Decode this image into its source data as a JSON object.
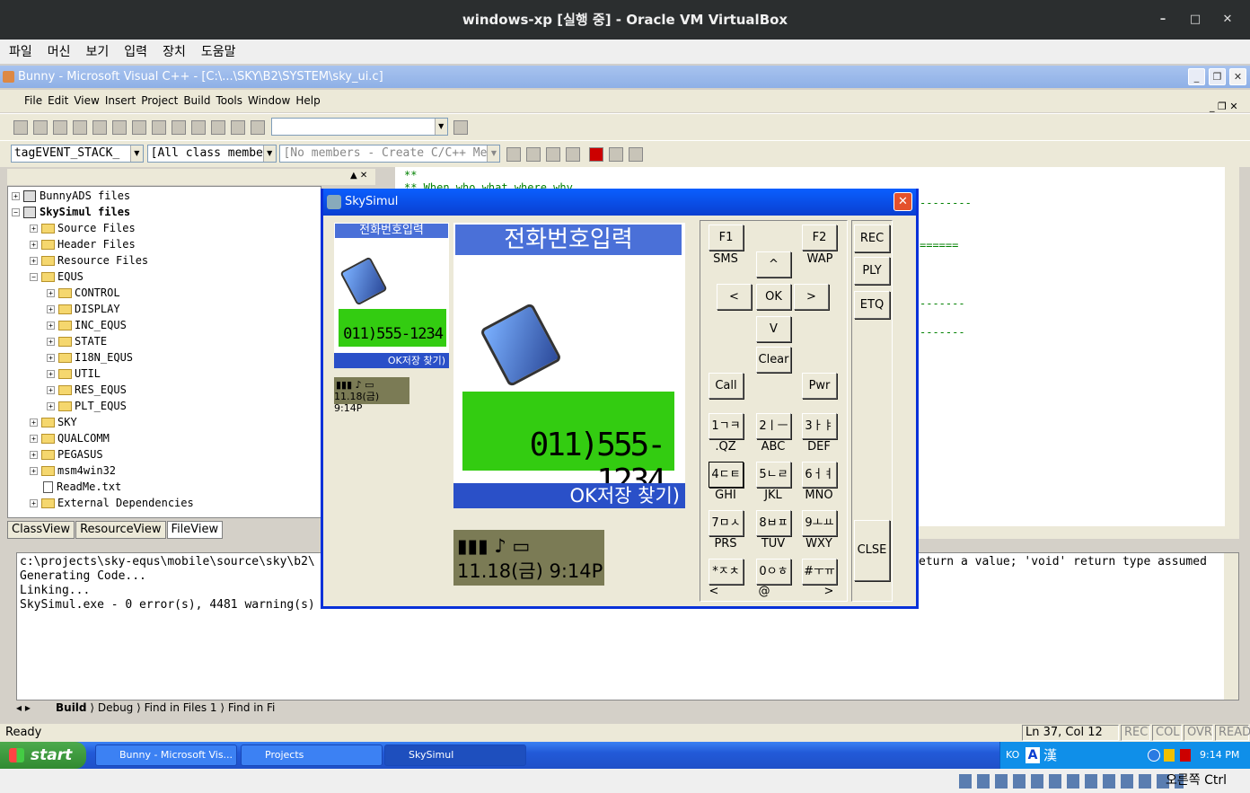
{
  "host": {
    "title": "windows-xp [실행 중] - Oracle VM VirtualBox",
    "menu": [
      "파일",
      "머신",
      "보기",
      "입력",
      "장치",
      "도움말"
    ],
    "status_host_key": "오른쪽 Ctrl"
  },
  "vc": {
    "title": "Bunny - Microsoft Visual C++ - [C:\\...\\SKY\\B2\\SYSTEM\\sky_ui.c]",
    "menu": [
      "File",
      "Edit",
      "View",
      "Insert",
      "Project",
      "Build",
      "Tools",
      "Window",
      "Help"
    ],
    "combo_class": "tagEVENT_STACK_",
    "combo_filter": "[All class members]",
    "combo_members": "[No members - Create C/C++ Memb"
  },
  "tree": {
    "rows": [
      {
        "label": "BunnyADS files"
      },
      {
        "label": "SkySimul files"
      },
      {
        "label": "Source Files"
      },
      {
        "label": "Header Files"
      },
      {
        "label": "Resource Files"
      },
      {
        "label": "EQUS"
      },
      {
        "label": "CONTROL"
      },
      {
        "label": "DISPLAY"
      },
      {
        "label": "INC_EQUS"
      },
      {
        "label": "STATE"
      },
      {
        "label": "I18N_EQUS"
      },
      {
        "label": "UTIL"
      },
      {
        "label": "RES_EQUS"
      },
      {
        "label": "PLT_EQUS"
      },
      {
        "label": "SKY"
      },
      {
        "label": "QUALCOMM"
      },
      {
        "label": "PEGASUS"
      },
      {
        "label": "msm4win32"
      },
      {
        "label": "ReadMe.txt"
      },
      {
        "label": "External Dependencies"
      }
    ],
    "tabs": [
      "ClassView",
      "ResourceView",
      "FileView"
    ]
  },
  "editor": {
    "line1": "**",
    "line2": "** When          who           what  where  why",
    "dashes": [
      "--------",
      "======",
      "-------",
      "-------"
    ]
  },
  "output": {
    "lines": [
      "c:\\projects\\sky-equs\\mobile\\source\\sky\\b2\\",
      "Generating Code...",
      "Linking...",
      "",
      "SkySimul.exe - 0 error(s), 4481 warning(s)"
    ],
    "right_text": "eturn a value; 'void' return type assumed",
    "tabs": [
      "Build",
      "Debug",
      "Find in Files 1",
      "Find in Fi"
    ]
  },
  "status": {
    "ready": "Ready",
    "position": "Ln 37, Col 12",
    "flags": [
      "REC",
      "COL",
      "OVR",
      "READ"
    ]
  },
  "taskbar": {
    "start": "start",
    "tasks": [
      "Bunny - Microsoft Vis...",
      "Projects",
      "SkySimul"
    ],
    "tray_lang": "KO",
    "tray_a": "A",
    "tray_han": "漢",
    "clock": "9:14 PM"
  },
  "sky": {
    "title": "SkySimul",
    "small": {
      "header": "전화번호입력",
      "number": "011)555-1234",
      "soft": "OK저장   찾기)",
      "status_date": "11.18(금) 9:14P"
    },
    "large": {
      "header": "전화번호입력",
      "number": "011)555-1234",
      "soft": "OK저장   찾기)",
      "status_date": "11.18(금)  9:14P"
    },
    "keys": {
      "f1": "F1",
      "f2": "F2",
      "sms": "SMS",
      "wap": "WAP",
      "up": "^",
      "left": "<",
      "ok": "OK",
      "right": ">",
      "down": "V",
      "clear": "Clear",
      "call": "Call",
      "pwr": "Pwr",
      "k1": "1ㄱㅋ",
      "k2": "2ㅣㅡ",
      "k3": "3ㅏㅑ",
      "k4": "4ㄷㅌ",
      "k5": "5ㄴㄹ",
      "k6": "6ㅓㅕ",
      "k7": "7ㅁㅅ",
      "k8": "8ㅂㅍ",
      "k9": "9ㅗㅛ",
      "kstar": "*ㅈㅊ",
      "k0": "0ㅇㅎ",
      "khash": "#ㅜㅠ",
      "l1": ".QZ",
      "l2": "ABC",
      "l3": "DEF",
      "l4": "GHI",
      "l5": "JKL",
      "l6": "MNO",
      "l7": "PRS",
      "l8": "TUV",
      "l9": "WXY",
      "lstar": "<",
      "l0": "@",
      "lhash": ">"
    },
    "side": [
      "REC",
      "PLY",
      "ETQ",
      "CLSE"
    ]
  }
}
